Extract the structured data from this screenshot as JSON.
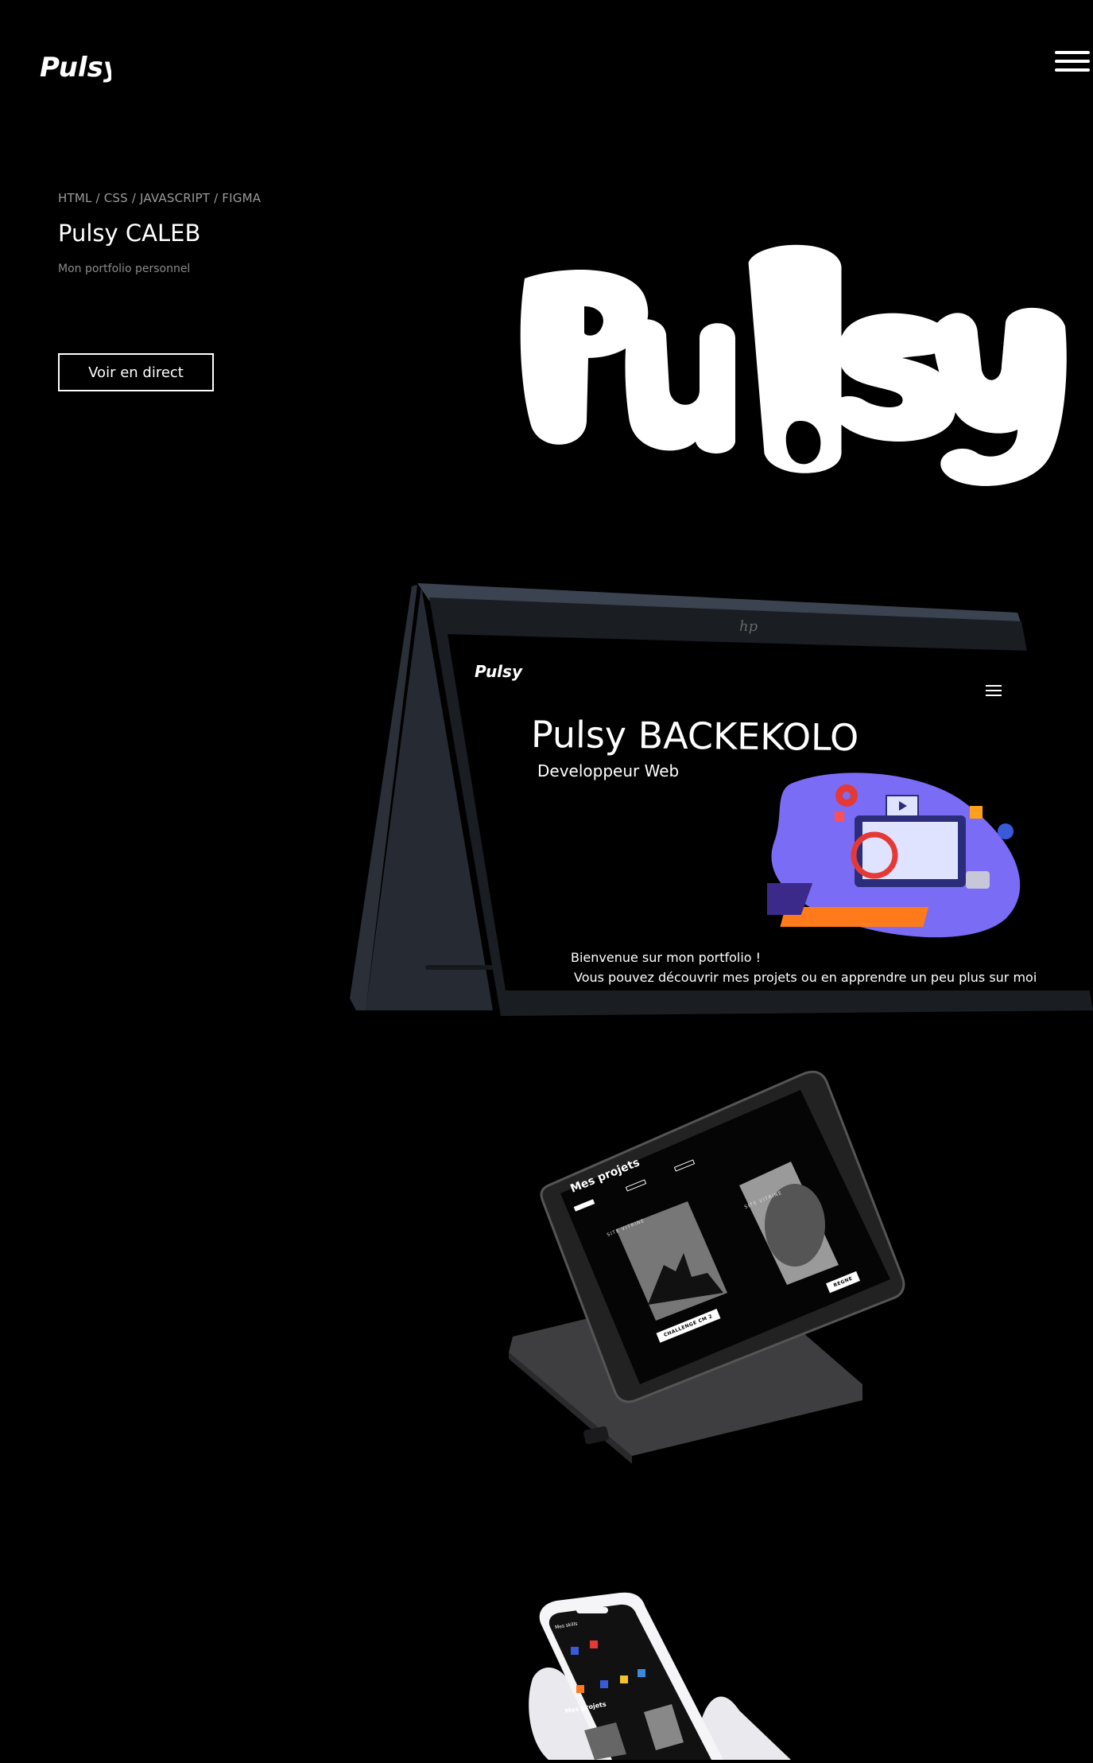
{
  "header": {
    "logo_text": "Pulsy",
    "menu_icon": "hamburger-menu-icon"
  },
  "hero": {
    "tags": "HTML / CSS / JAVASCRIPT / FIGMA",
    "name": "Pulsy CALEB",
    "subtitle": "Mon portfolio personnel",
    "cta_label": "Voir en direct",
    "big_logo_text": "Pulsy"
  },
  "laptop_screen": {
    "brand_mark": "hp",
    "logo": "Pulsy",
    "title": "Pulsy BACKEKOLO",
    "role": "Developpeur Web",
    "welcome": "Bienvenue sur mon portfolio !",
    "description": "Vous pouvez découvrir mes projets ou en apprendre un peu plus sur moi"
  },
  "tablet_screen": {
    "title": "Mes projets",
    "filters": [
      "",
      "",
      ""
    ],
    "project_1_caption": "SITE VITRINE",
    "project_1_button": "CHALLENGE CM 2",
    "project_2_caption": "SITE VITRINE",
    "project_2_button": "REGNE"
  },
  "phone_screen": {
    "title": "Mes skills",
    "projects_title": "Mes projets"
  },
  "colors": {
    "background": "#000000",
    "text": "#ffffff",
    "muted": "#9a9a9a",
    "accent_purple": "#7b6cf6",
    "accent_red": "#e53935",
    "accent_orange": "#ff7a1a"
  }
}
